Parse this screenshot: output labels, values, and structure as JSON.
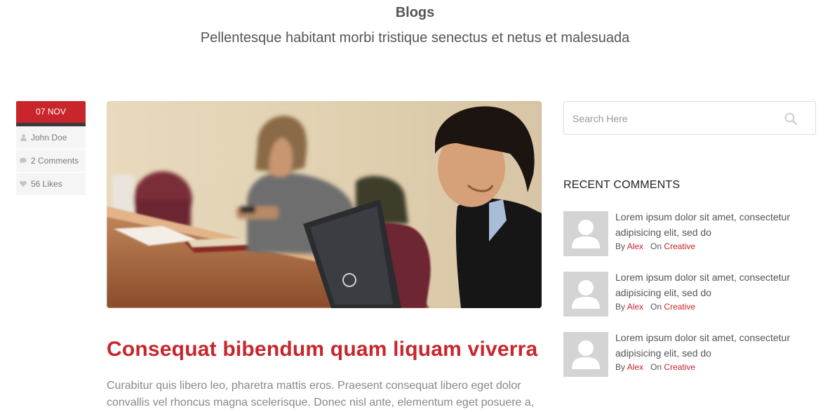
{
  "header": {
    "title": "Blogs",
    "subtitle": "Pellentesque habitant morbi tristique senectus et netus et malesuada"
  },
  "post": {
    "date": "07 NOV",
    "author": "John Doe",
    "comments": "2 Comments",
    "likes": "56 Likes",
    "title": "Consequat bibendum quam liquam viverra",
    "excerpt": "Curabitur quis libero leo, pharetra mattis eros. Praesent consequat libero eget dolor convallis vel rhoncus magna scelerisque. Donec nisl ante, elementum eget posuere a,"
  },
  "sidebar": {
    "search": {
      "placeholder": "Search Here"
    },
    "recent_comments": {
      "heading": "RECENT COMMENTS",
      "items": [
        {
          "text": "Lorem ipsum dolor sit amet, consectetur adipisicing elit, sed do",
          "by_label": "By",
          "author": "Alex",
          "on_label": "On",
          "category": "Creative"
        },
        {
          "text": "Lorem ipsum dolor sit amet, consectetur adipisicing elit, sed do",
          "by_label": "By",
          "author": "Alex",
          "on_label": "On",
          "category": "Creative"
        },
        {
          "text": "Lorem ipsum dolor sit amet, consectetur adipisicing elit, sed do",
          "by_label": "By",
          "author": "Alex",
          "on_label": "On",
          "category": "Creative"
        }
      ]
    }
  },
  "icons": {
    "author": "user-icon",
    "comments": "comment-icon",
    "likes": "heart-icon",
    "search": "search-icon",
    "avatar": "avatar-placeholder-icon"
  },
  "colors": {
    "accent": "#c9252c",
    "strip": "#3a3a3a",
    "meta_bg": "#f5f5f5",
    "avatar_bg": "#d4d4d4"
  }
}
